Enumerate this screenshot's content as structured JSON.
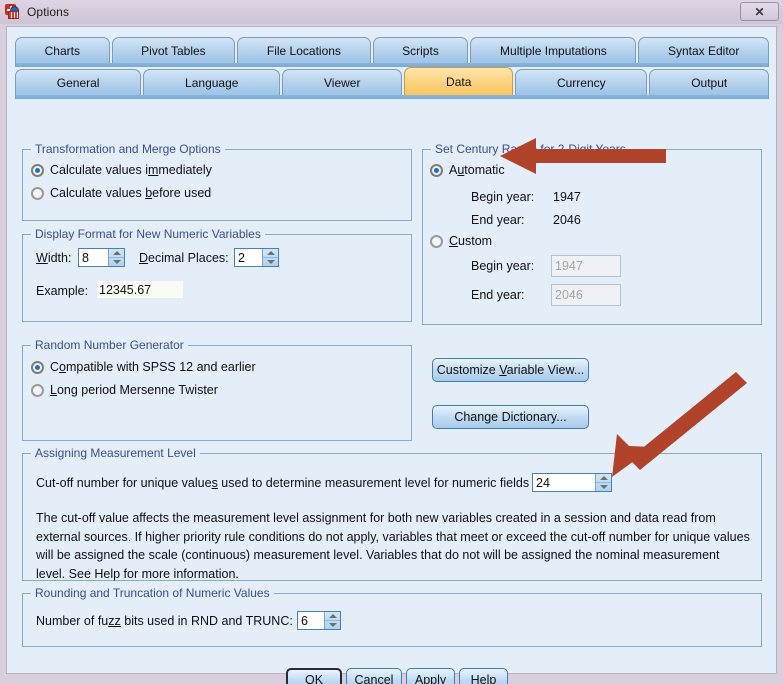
{
  "window": {
    "title": "Options",
    "icon": "spss-logo-icon",
    "close_label": "✕",
    "annotation_color": "#b1432a"
  },
  "tabs": {
    "row1": [
      {
        "label": "Charts",
        "selected": false
      },
      {
        "label": "Pivot Tables",
        "selected": false
      },
      {
        "label": "File Locations",
        "selected": false
      },
      {
        "label": "Scripts",
        "selected": false
      },
      {
        "label": "Multiple Imputations",
        "selected": false
      },
      {
        "label": "Syntax Editor",
        "selected": false
      }
    ],
    "row2": [
      {
        "label": "General",
        "selected": false
      },
      {
        "label": "Language",
        "selected": false
      },
      {
        "label": "Viewer",
        "selected": false
      },
      {
        "label": "Data",
        "selected": true
      },
      {
        "label": "Currency",
        "selected": false
      },
      {
        "label": "Output",
        "selected": false
      }
    ]
  },
  "transformation_group": {
    "legend": "Transformation and Merge Options",
    "options": [
      {
        "label_pre": "Calculate values i",
        "label_key": "m",
        "label_post": "mediately",
        "selected": true
      },
      {
        "label_pre": "Calculate values ",
        "label_key": "b",
        "label_post": "efore used",
        "selected": false
      }
    ]
  },
  "display_format_group": {
    "legend": "Display Format for New Numeric Variables",
    "width_label_key": "W",
    "width_label_post": "idth:",
    "width_value": "8",
    "decimals_label_key": "D",
    "decimals_label_post": "ecimal Places:",
    "decimals_value": "2",
    "example_label": "Example:",
    "example_value": "12345.67"
  },
  "random_group": {
    "legend": "Random Number Generator",
    "options": [
      {
        "label_pre": "C",
        "label_key": "o",
        "label_post": "mpatible with SPSS 12 and earlier",
        "selected": true
      },
      {
        "label_pre": "",
        "label_key": "L",
        "label_post": "ong period Mersenne Twister",
        "selected": false
      }
    ]
  },
  "century_group": {
    "legend": "Set Century Range for 2-Digit Years",
    "automatic": {
      "label_pre": "A",
      "label_key": "u",
      "label_post": "tomatic",
      "selected": true,
      "begin_label": "Begin year:",
      "begin_value": "1947",
      "end_label": "End year:",
      "end_value": "2046"
    },
    "custom": {
      "label_pre": "",
      "label_key": "C",
      "label_post": "ustom",
      "selected": false,
      "begin_label": "Begin year:",
      "begin_value": "1947",
      "end_label": "End year:",
      "end_value": "2046",
      "disabled": true
    }
  },
  "side_buttons": [
    {
      "label_pre": "Customize ",
      "label_key": "V",
      "label_post": "ariable View..."
    },
    {
      "label_pre": "Chan",
      "label_key": "g",
      "label_post": "e Dictionary..."
    }
  ],
  "measurement_group": {
    "legend": "Assigning Measurement Level",
    "cutoff_label_pre": "Cut-off number for unique value",
    "cutoff_label_key": "s",
    "cutoff_label_post": " used to determine measurement level for numeric fields",
    "cutoff_value": "24",
    "description": "The cut-off value affects the measurement level assignment for both new variables created in a session and data read from external sources. If higher priority rule conditions do not apply, variables that meet or exceed the cut-off number for unique values will be assigned the scale (continuous) measurement level. Variables that do not will be assigned the nominal measurement level. See Help for more information."
  },
  "rounding_group": {
    "legend": "Rounding and Truncation of Numeric Values",
    "fuzz_label_pre": "Number of fu",
    "fuzz_label_key": "zz",
    "fuzz_label_post": " bits used in RND and TRUNC:",
    "fuzz_value": "6"
  },
  "footer_buttons": [
    {
      "label_pre": "OK",
      "label_key": "",
      "label_post": "",
      "focused": true
    },
    {
      "label_pre": "Cancel",
      "label_key": "",
      "label_post": "",
      "focused": false
    },
    {
      "label_pre": "",
      "label_key": "A",
      "label_post": "pply",
      "focused": false
    },
    {
      "label_pre": "Help",
      "label_key": "",
      "label_post": "",
      "focused": false
    }
  ]
}
